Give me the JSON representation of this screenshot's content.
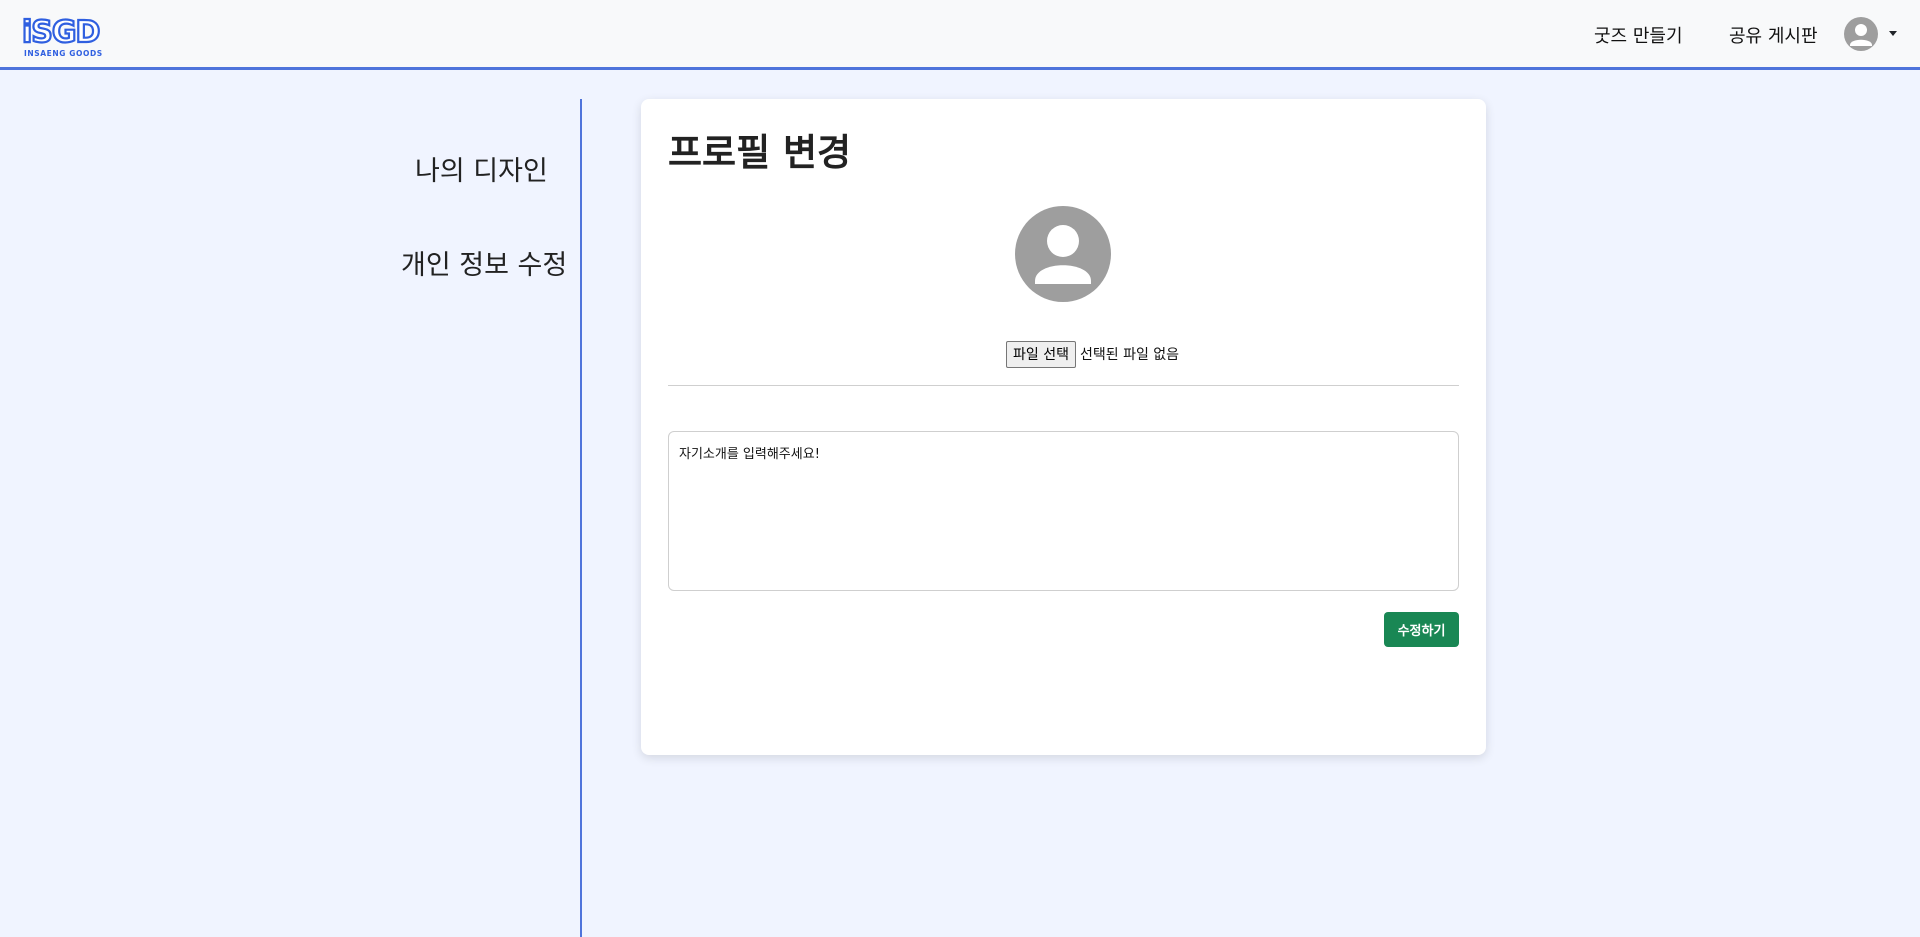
{
  "header": {
    "logo_text": "iSGD",
    "logo_subtext": "INSAENG GOODS",
    "nav_goods": "굿즈 만들기",
    "nav_board": "공유 게시판",
    "avatar_icon": "user-avatar-icon",
    "dropdown_icon": "caret-down-icon"
  },
  "sidebar": {
    "items": [
      {
        "label": "나의 디자인"
      },
      {
        "label": "개인 정보 수정"
      }
    ]
  },
  "profile": {
    "title": "프로필 변경",
    "avatar_icon": "user-avatar-icon",
    "file_button": "파일 선택",
    "file_status": "선택된 파일 없음",
    "intro_value": "자기소개를 입력해주세요!",
    "submit_label": "수정하기"
  },
  "colors": {
    "background": "#f0f4ff",
    "accent": "#4f74db",
    "submit": "#198754",
    "avatar": "#9e9e9e"
  }
}
